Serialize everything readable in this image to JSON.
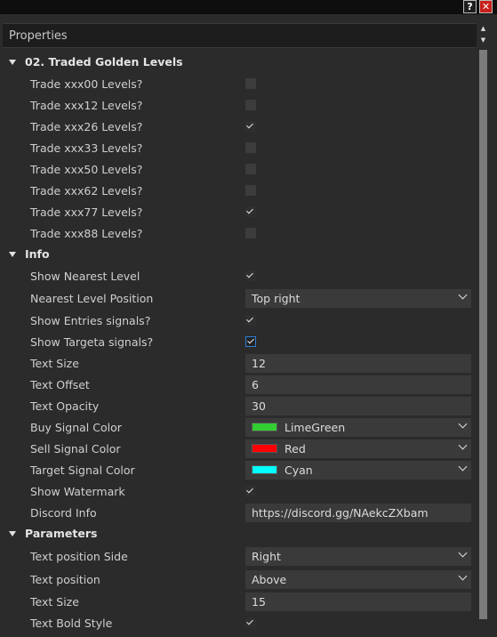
{
  "titlebar": {
    "help": "?",
    "close": "✕"
  },
  "panel": {
    "title": "Properties"
  },
  "colors": {
    "limegreen": "#32cd32",
    "red": "#ff0000",
    "cyan": "#00ffff"
  },
  "sections": {
    "traded": {
      "label": "02. Traded Golden Levels",
      "items": [
        {
          "label": "Trade xxx00 Levels?",
          "checked": false
        },
        {
          "label": "Trade xxx12 Levels?",
          "checked": false
        },
        {
          "label": "Trade xxx26 Levels?",
          "checked": true
        },
        {
          "label": "Trade xxx33 Levels?",
          "checked": false
        },
        {
          "label": "Trade xxx50 Levels?",
          "checked": false
        },
        {
          "label": "Trade xxx62 Levels?",
          "checked": false
        },
        {
          "label": "Trade xxx77 Levels?",
          "checked": true
        },
        {
          "label": "Trade xxx88 Levels?",
          "checked": false
        }
      ]
    },
    "info": {
      "label": "Info",
      "show_nearest": {
        "label": "Show Nearest Level",
        "checked": true
      },
      "nearest_position": {
        "label": "Nearest Level Position",
        "value": "Top right"
      },
      "show_entries": {
        "label": "Show Entries signals?",
        "checked": true
      },
      "show_targets": {
        "label": "Show Targeta signals?",
        "checked": true
      },
      "text_size": {
        "label": "Text Size",
        "value": "12"
      },
      "text_offset": {
        "label": "Text Offset",
        "value": "6"
      },
      "text_opacity": {
        "label": "Text Opacity",
        "value": "30"
      },
      "buy_color": {
        "label": "Buy Signal Color",
        "value": "LimeGreen"
      },
      "sell_color": {
        "label": "Sell Signal Color",
        "value": "Red"
      },
      "target_color": {
        "label": "Target Signal Color",
        "value": "Cyan"
      },
      "show_watermark": {
        "label": "Show Watermark",
        "checked": true
      },
      "discord": {
        "label": "Discord Info",
        "value": "https://discord.gg/NAekcZXbam"
      }
    },
    "parameters": {
      "label": "Parameters",
      "position_side": {
        "label": "Text position Side",
        "value": "Right"
      },
      "position": {
        "label": "Text position",
        "value": "Above"
      },
      "text_size": {
        "label": "Text Size",
        "value": "15"
      },
      "bold_style": {
        "label": "Text Bold Style",
        "checked": true
      }
    }
  }
}
